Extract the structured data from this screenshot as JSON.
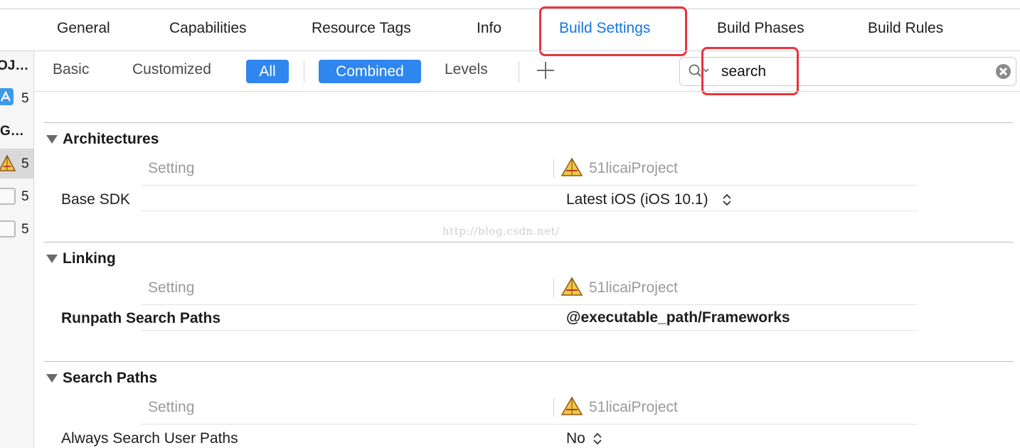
{
  "tabs": [
    {
      "label": "General"
    },
    {
      "label": "Capabilities"
    },
    {
      "label": "Resource Tags"
    },
    {
      "label": "Info"
    },
    {
      "label": "Build Settings",
      "active": true
    },
    {
      "label": "Build Phases"
    },
    {
      "label": "Build Rules"
    }
  ],
  "sidebar": {
    "project_header": "OJ…",
    "project_item_label": "5",
    "targets_header": "G…",
    "items": [
      {
        "label": "5",
        "icon": "app-target-icon"
      },
      {
        "label": "5",
        "icon": "bundle-target-icon"
      },
      {
        "label": "5",
        "icon": "bundle-target-icon"
      }
    ]
  },
  "filters": {
    "basic": "Basic",
    "customized": "Customized",
    "all": "All",
    "combined": "Combined",
    "levels": "Levels"
  },
  "search": {
    "value": "search"
  },
  "column_header": "Setting",
  "target_column": "51licaiProject",
  "watermark": "http://blog.csdn.net/",
  "sections": [
    {
      "title": "Architectures",
      "setting": "Base SDK",
      "value": "Latest iOS (iOS 10.1)"
    },
    {
      "title": "Linking",
      "setting": "Runpath Search Paths",
      "value": "@executable_path/Frameworks"
    },
    {
      "title": "Search Paths",
      "setting": "Always Search User Paths",
      "value": "No"
    }
  ],
  "colors": {
    "accent": "#1577e3",
    "selected_pill": "#2f86ee",
    "highlight": "#e8343f"
  }
}
